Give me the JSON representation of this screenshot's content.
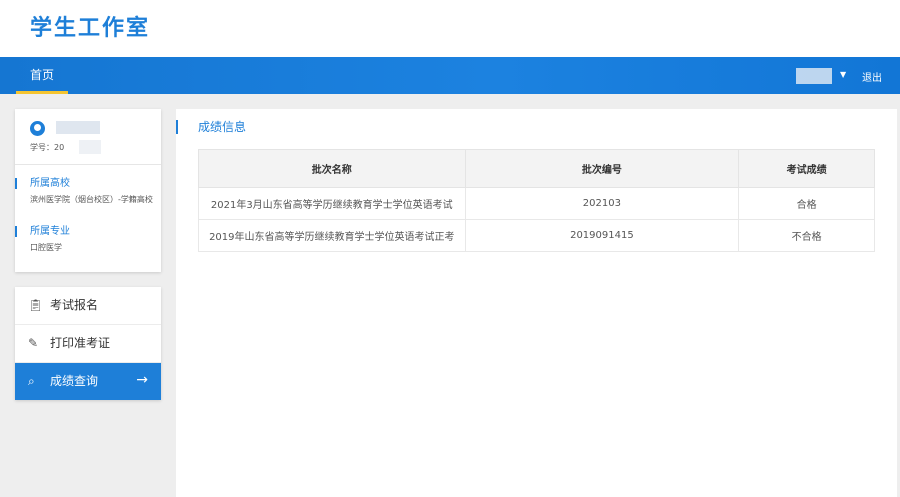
{
  "app": {
    "title": "学生工作室"
  },
  "nav": {
    "home": "首页",
    "logout": "退出"
  },
  "profile": {
    "student_id_label": "学号：20",
    "school_title": "所属高校",
    "school_value": "滨州医学院（烟台校区）-学籍高校",
    "major_title": "所属专业",
    "major_value": "口腔医学"
  },
  "menu": {
    "items": [
      {
        "label": "考试报名",
        "icon": "clipboard-icon"
      },
      {
        "label": "打印准考证",
        "icon": "pencil-icon"
      },
      {
        "label": "成绩查询",
        "icon": "score-search-icon",
        "active": true
      }
    ]
  },
  "main": {
    "title": "成绩信息",
    "columns": [
      "批次名称",
      "批次编号",
      "考试成绩"
    ],
    "rows": [
      [
        "2021年3月山东省高等学历继续教育学士学位英语考试",
        "202103",
        "合格"
      ],
      [
        "2019年山东省高等学历继续教育学士学位英语考试正考",
        "2019091415",
        "不合格"
      ]
    ]
  },
  "colors": {
    "accent": "#1e7fd8",
    "nav_underline": "#f4c430"
  }
}
